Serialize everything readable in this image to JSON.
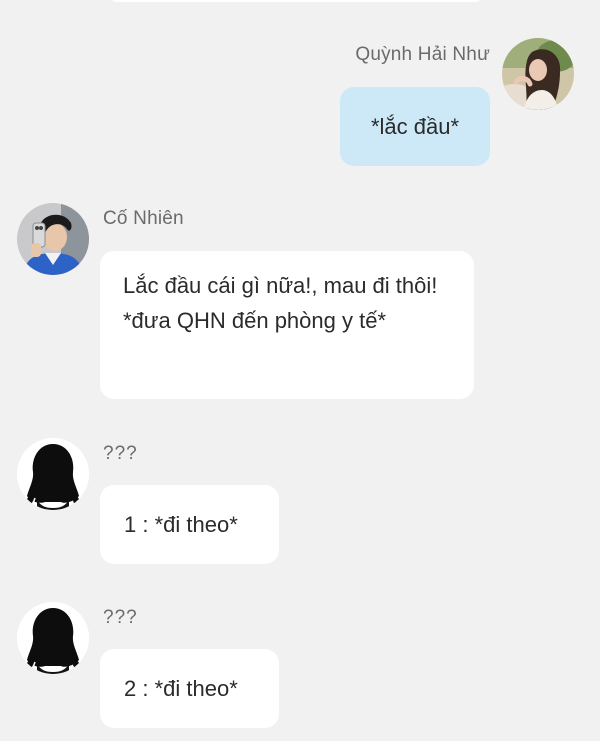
{
  "messages": [
    {
      "id": "msg-1",
      "direction": "outgoing",
      "sender_name": "Quỳnh Hải Như",
      "avatar": "photo-avatar",
      "text": "*lắc đầu*"
    },
    {
      "id": "msg-2",
      "direction": "incoming",
      "sender_name": "Cố Nhiên",
      "avatar": "photo-avatar",
      "text": "Lắc đầu cái gì nữa!, mau đi thôi! *đưa QHN đến phòng y tế*"
    },
    {
      "id": "msg-3",
      "direction": "incoming",
      "sender_name": "???",
      "avatar": "silhouette-avatar-icon",
      "text": "1 : *đi theo*"
    },
    {
      "id": "msg-4",
      "direction": "incoming",
      "sender_name": "???",
      "avatar": "silhouette-avatar-icon",
      "text": "2 : *đi theo*"
    }
  ],
  "colors": {
    "background": "#f1f1f1",
    "outgoing_bubble": "#cde9f7",
    "incoming_bubble": "#ffffff",
    "name_text": "#6b6b6b",
    "message_text": "#2b2b2b"
  }
}
